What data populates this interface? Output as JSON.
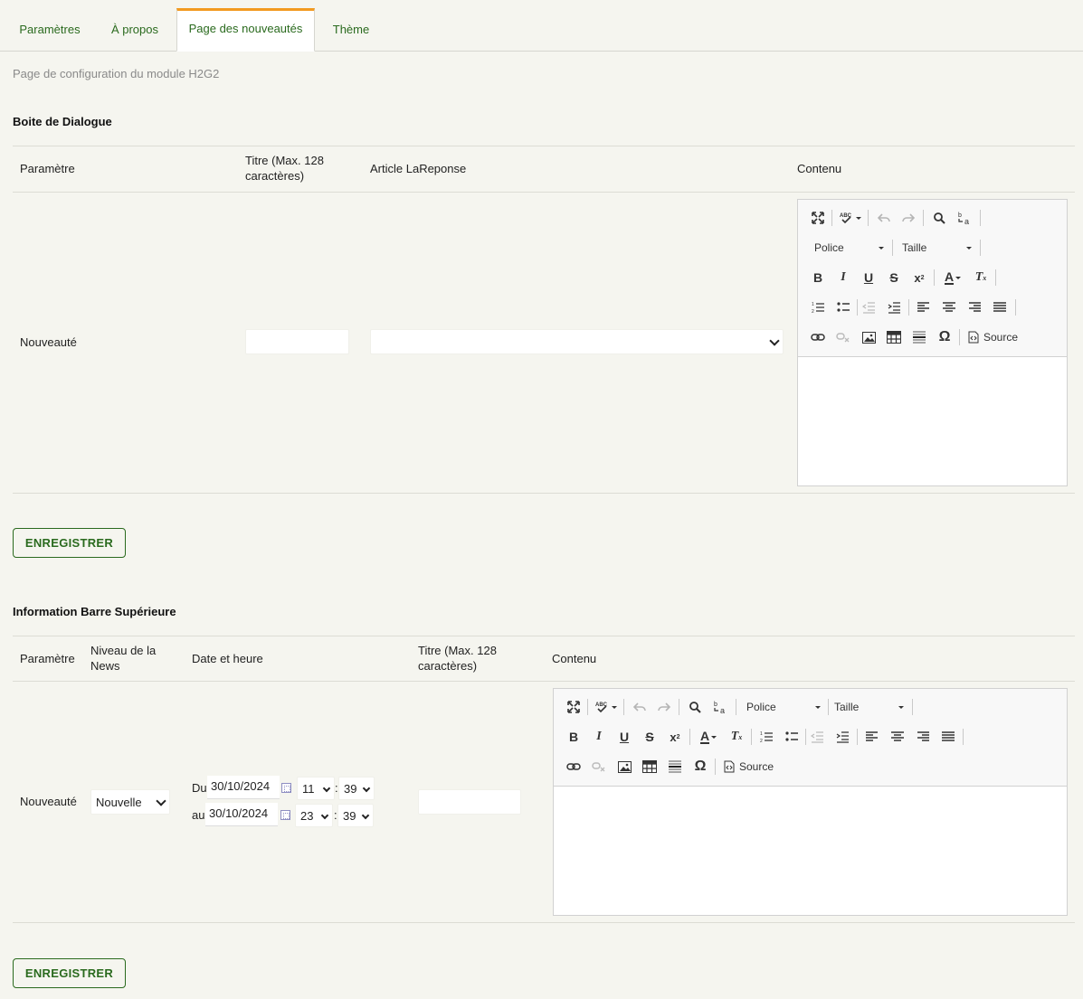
{
  "tabs": [
    {
      "label": "Paramètres"
    },
    {
      "label": "À propos"
    },
    {
      "label": "Page des nouveautés"
    },
    {
      "label": "Thème"
    }
  ],
  "subtitle": "Page de configuration du module H2G2",
  "dialog": {
    "title": "Boite de Dialogue",
    "headers": {
      "param": "Paramètre",
      "titre": "Titre (Max. 128 caractères)",
      "article": "Article LaReponse",
      "contenu": "Contenu"
    },
    "row_label": "Nouveauté",
    "titre_value": "",
    "article_value": "",
    "save_label": "ENREGISTRER"
  },
  "editor": {
    "font_label": "Police",
    "size_label": "Taille",
    "source_label": "Source",
    "content": ""
  },
  "topbar": {
    "title": "Information Barre Supérieure",
    "headers": {
      "param": "Paramètre",
      "niveau": "Niveau de la News",
      "date": "Date et heure",
      "titre": "Titre (Max. 128 caractères)",
      "contenu": "Contenu"
    },
    "row_label": "Nouveauté",
    "niveau_value": "Nouvelle",
    "from_label": "Du",
    "to_label": "au",
    "from_date": "30/10/2024",
    "to_date": "30/10/2024",
    "from_hour": "11",
    "from_min": "39",
    "to_hour": "23",
    "to_min": "39",
    "colon": ":",
    "titre_value": "",
    "save_label": "ENREGISTRER"
  },
  "colors": {
    "accent_green": "#2a6a1e",
    "tab_active_border": "#f29a1f",
    "background": "#f5f5ef"
  }
}
